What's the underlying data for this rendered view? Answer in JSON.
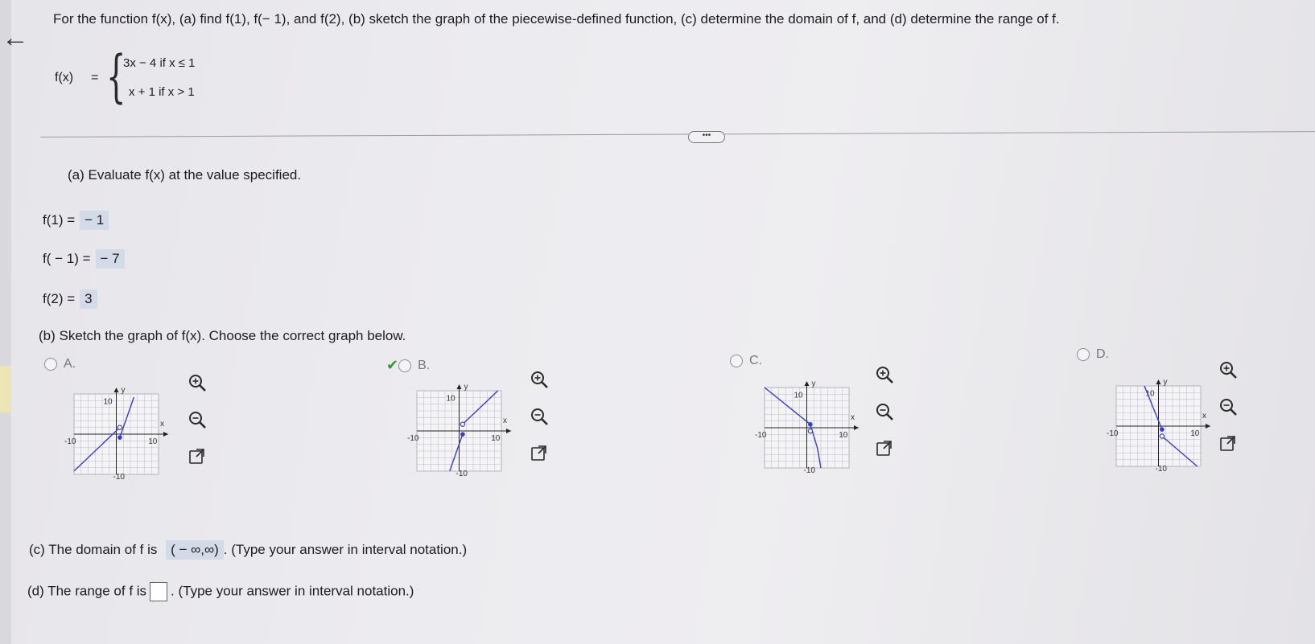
{
  "header": {
    "question": "For the function f(x), (a) find f(1), f(− 1), and f(2), (b) sketch the graph of the piecewise-defined function, (c) determine the domain of f, and (d) determine the range of f."
  },
  "function": {
    "label": "f(x)",
    "equals": "=",
    "piece1": "3x − 4  if x ≤ 1",
    "piece2": "x + 1  if x > 1"
  },
  "ellipsis": "•••",
  "part_a": {
    "prompt": "(a) Evaluate f(x) at the value specified.",
    "rows": [
      {
        "label": "f(1) =",
        "value": "− 1"
      },
      {
        "label": "f( − 1) =",
        "value": "− 7"
      },
      {
        "label": "f(2) =",
        "value": "3"
      }
    ]
  },
  "part_b": {
    "prompt": "(b) Sketch the graph of f(x). Choose the correct graph below.",
    "options": [
      {
        "label": "A.",
        "selected": false
      },
      {
        "label": "B.",
        "selected": true
      },
      {
        "label": "C.",
        "selected": false
      },
      {
        "label": "D.",
        "selected": false
      }
    ],
    "axis": {
      "x": "x",
      "y": "y",
      "tick_pos": "10",
      "tick_neg": "-10"
    }
  },
  "part_c": {
    "prefix": "(c) The domain of f is",
    "answer": "( − ∞,∞)",
    "suffix": ". (Type your answer in interval notation.)"
  },
  "part_d": {
    "prefix": "(d) The range of f is",
    "suffix": ". (Type your answer in interval notation.)"
  },
  "colors": {
    "accent": "#3a3ad6",
    "answer_bg": "#d4dbe8",
    "correct": "#2f9c2f"
  },
  "icons": [
    "back-arrow-icon",
    "zoom-in-icon",
    "zoom-out-icon",
    "popout-icon"
  ]
}
